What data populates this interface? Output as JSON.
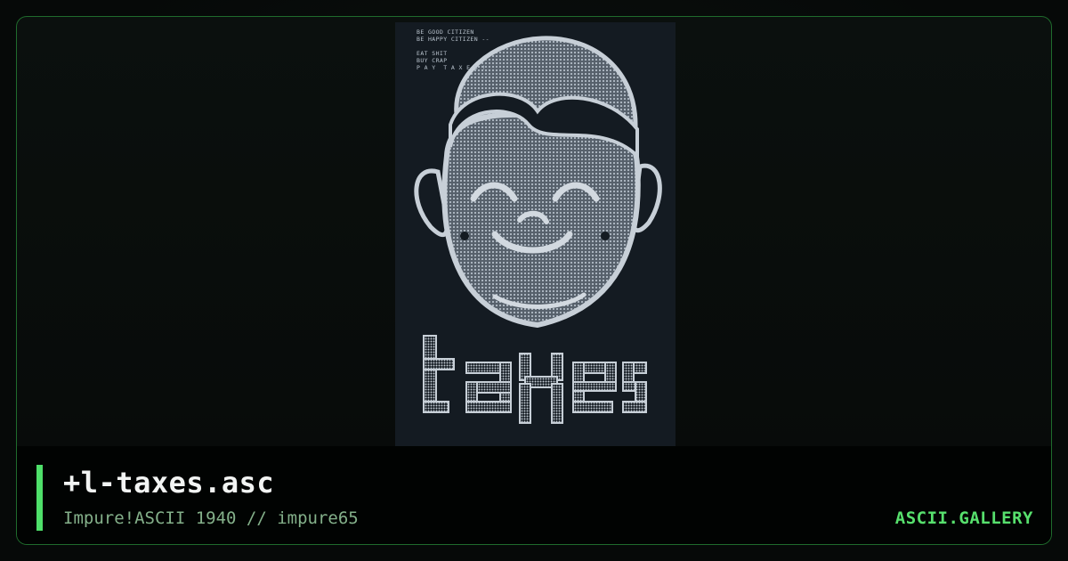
{
  "artwork": {
    "text_lines": [
      "BE GOOD CITIZEN",
      "BE HAPPY CITIZEN --",
      "",
      "EAT SHIT",
      "BUY CRAP",
      "P A Y  T A X E S !"
    ],
    "big_word": "taxes"
  },
  "caption": {
    "title": "+l-taxes.asc",
    "subtitle": "Impure!ASCII 1940 // impure65"
  },
  "brand": "ASCII.GALLERY",
  "colors": {
    "accent": "#4ee06a",
    "frame_border": "#1f6b2c",
    "art_background": "#141b22",
    "art_foreground": "#aab4be"
  }
}
